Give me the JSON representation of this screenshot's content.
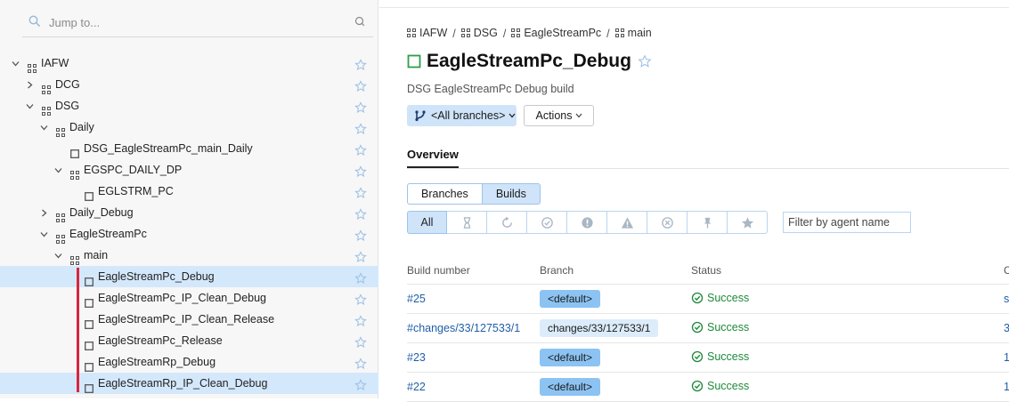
{
  "search": {
    "placeholder": "Jump to..."
  },
  "tree": [
    {
      "label": "IAFW",
      "level": 0,
      "chevron": "down",
      "type": "project",
      "selected": false
    },
    {
      "label": "DCG",
      "level": 1,
      "chevron": "right",
      "type": "project",
      "selected": false
    },
    {
      "label": "DSG",
      "level": 1,
      "chevron": "down",
      "type": "project",
      "selected": false
    },
    {
      "label": "Daily",
      "level": 2,
      "chevron": "down",
      "type": "project",
      "selected": false
    },
    {
      "label": "DSG_EagleStreamPc_main_Daily",
      "level": 3,
      "chevron": "none",
      "type": "build",
      "selected": false
    },
    {
      "label": "EGSPC_DAILY_DP",
      "level": 3,
      "chevron": "down",
      "type": "project",
      "selected": false
    },
    {
      "label": "EGLSTRM_PC",
      "level": 4,
      "chevron": "none",
      "type": "build",
      "selected": false
    },
    {
      "label": "Daily_Debug",
      "level": 2,
      "chevron": "right",
      "type": "project",
      "selected": false
    },
    {
      "label": "EagleStreamPc",
      "level": 2,
      "chevron": "down",
      "type": "project",
      "selected": false
    },
    {
      "label": "main",
      "level": 3,
      "chevron": "down",
      "type": "project",
      "selected": false
    },
    {
      "label": "EagleStreamPc_Debug",
      "level": 4,
      "chevron": "none",
      "type": "build",
      "selected": true
    },
    {
      "label": "EagleStreamPc_IP_Clean_Debug",
      "level": 4,
      "chevron": "none",
      "type": "build",
      "selected": false
    },
    {
      "label": "EagleStreamPc_IP_Clean_Release",
      "level": 4,
      "chevron": "none",
      "type": "build",
      "selected": false
    },
    {
      "label": "EagleStreamPc_Release",
      "level": 4,
      "chevron": "none",
      "type": "build",
      "selected": false
    },
    {
      "label": "EagleStreamRp_Debug",
      "level": 4,
      "chevron": "none",
      "type": "build",
      "selected": false
    },
    {
      "label": "EagleStreamRp_IP_Clean_Debug",
      "level": 4,
      "chevron": "none",
      "type": "build",
      "selected": true
    }
  ],
  "breadcrumb": [
    "IAFW",
    "DSG",
    "EagleStreamPc",
    "main"
  ],
  "breadcrumb_sep": "/",
  "title": "EagleStreamPc_Debug",
  "description": "DSG EagleStreamPc Debug build",
  "branch_selector": "<All branches>",
  "actions_label": "Actions",
  "overview_tab": "Overview",
  "view_toggle": {
    "branches": "Branches",
    "builds": "Builds",
    "active": "builds"
  },
  "filters": [
    {
      "name": "all",
      "label": "All",
      "active": true
    },
    {
      "name": "queued",
      "icon": "hourglass-icon"
    },
    {
      "name": "running",
      "icon": "spinner-icon"
    },
    {
      "name": "success",
      "icon": "check-circle-icon"
    },
    {
      "name": "failed",
      "icon": "exclamation-icon"
    },
    {
      "name": "warning",
      "icon": "warning-icon"
    },
    {
      "name": "cancelled",
      "icon": "cross-circle-icon"
    },
    {
      "name": "pinned",
      "icon": "pin-icon"
    },
    {
      "name": "starred",
      "icon": "star-icon"
    }
  ],
  "agent_filter": {
    "placeholder": "Filter by agent name"
  },
  "table": {
    "headers": {
      "number": "Build number",
      "branch": "Branch",
      "status": "Status",
      "extra": "C"
    },
    "rows": [
      {
        "number": "#25",
        "branch": "<default>",
        "default": true,
        "status": "Success",
        "extra": "s"
      },
      {
        "number": "#changes/33/127533/1",
        "branch": "changes/33/127533/1",
        "default": false,
        "status": "Success",
        "extra": "3"
      },
      {
        "number": "#23",
        "branch": "<default>",
        "default": true,
        "status": "Success",
        "extra": "1"
      },
      {
        "number": "#22",
        "branch": "<default>",
        "default": true,
        "status": "Success",
        "extra": "1"
      }
    ]
  },
  "colors": {
    "accent": "#cfe4f9",
    "success": "#1d8a3a",
    "link": "#1f5fa8",
    "selection_bar": "#d7263d"
  }
}
